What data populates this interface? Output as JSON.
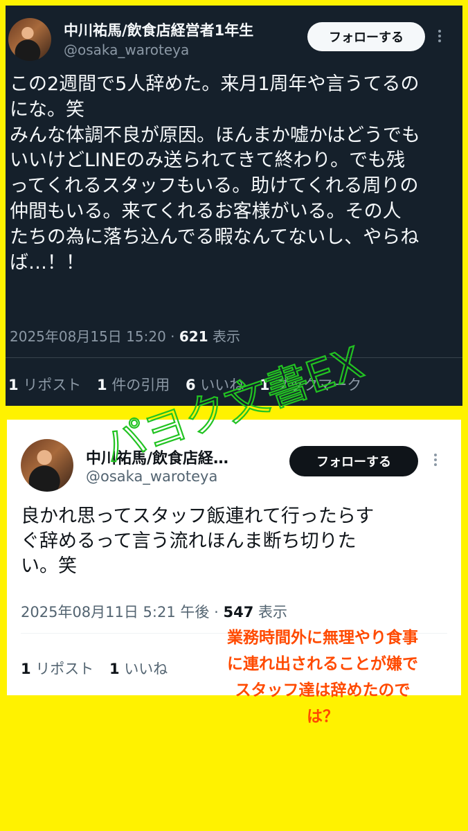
{
  "tweet1": {
    "author_name": "中川祐馬/飲食店経営者1年生",
    "handle": "@osaka_waroteya",
    "follow_label": "フォローする",
    "body_lines": [
      "この2週間で5人辞めた。来月1周年や言うてるの",
      "にな。笑",
      "みんな体調不良が原因。ほんまか嘘かはどうでも",
      "いいけどLINEのみ送られてきて終わり。でも残",
      "ってくれるスタッフもいる。助けてくれる周りの",
      "仲間もいる。来てくれるお客様がいる。その人",
      "たちの為に落ち込んでる暇なんてないし、やらね",
      "ば…！！"
    ],
    "timestamp": "2025年08月15日 15:20",
    "separator": "·",
    "views_count": "621",
    "views_label": "表示",
    "stats": [
      {
        "num": "1",
        "label": "リポスト"
      },
      {
        "num": "1",
        "label": "件の引用"
      },
      {
        "num": "6",
        "label": "いいね"
      },
      {
        "num": "1",
        "label": "ブックマーク"
      }
    ],
    "colors": {
      "background": "#15202b",
      "text": "#f5f8fa",
      "muted": "#8b98a5"
    }
  },
  "tweet2": {
    "author_name": "中川祐馬/飲食店経…",
    "handle": "@osaka_waroteya",
    "follow_label": "フォローする",
    "body_lines": [
      "良かれ思ってスタッフ飯連れて行ったらす",
      "ぐ辞めるって言う流れほんま断ち切りた",
      "い。笑"
    ],
    "timestamp": "2025年08月11日 5:21 午後",
    "separator": "·",
    "views_count": "547",
    "views_label": "表示",
    "stats": [
      {
        "num": "1",
        "label": "リポスト"
      },
      {
        "num": "1",
        "label": "いいね"
      }
    ],
    "colors": {
      "background": "#ffffff",
      "text": "#0f1419",
      "muted": "#536471"
    }
  },
  "watermark": {
    "text": "パヨク文書EX",
    "color": "#22c322"
  },
  "annotation": {
    "lines": [
      "業務時間外に無理やり食事",
      "に連れ出されることが嫌で",
      "スタッフ達は辞めたので",
      "は？"
    ],
    "color": "#ff4a00"
  },
  "page": {
    "background": "#fff200"
  },
  "icons": [
    "avatar",
    "more-icon"
  ]
}
